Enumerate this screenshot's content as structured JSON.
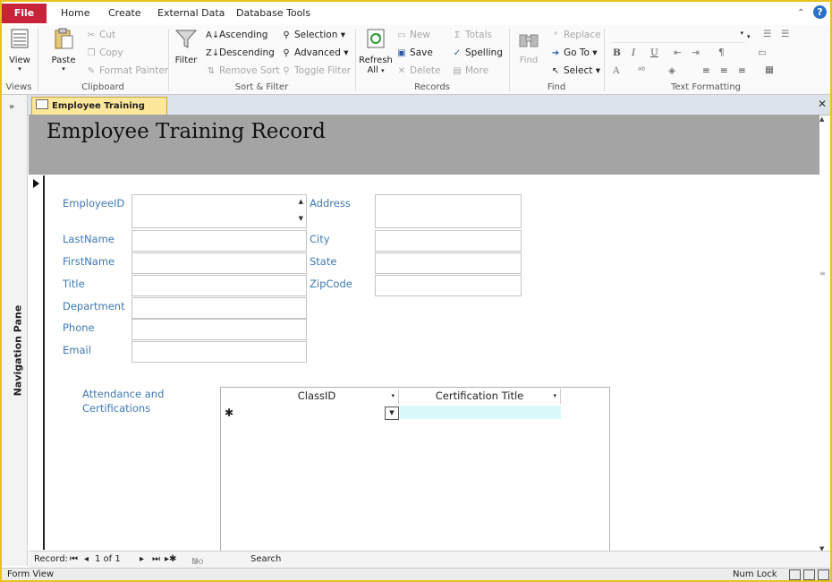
{
  "tabs": {
    "file": "File",
    "home": "Home",
    "create": "Create",
    "external": "External Data",
    "dbtools": "Database Tools"
  },
  "ribbon": {
    "views": {
      "label": "Views",
      "view": "View"
    },
    "clipboard": {
      "label": "Clipboard",
      "paste": "Paste",
      "cut": "Cut",
      "copy": "Copy",
      "format_painter": "Format Painter"
    },
    "sort": {
      "label": "Sort & Filter",
      "filter": "Filter",
      "ascending": "Ascending",
      "descending": "Descending",
      "remove_sort": "Remove Sort",
      "selection": "Selection",
      "advanced": "Advanced",
      "toggle_filter": "Toggle Filter"
    },
    "records": {
      "label": "Records",
      "refresh": "Refresh",
      "refresh2": "All",
      "new": "New",
      "save": "Save",
      "delete": "Delete",
      "totals": "Totals",
      "spelling": "Spelling",
      "more": "More"
    },
    "find": {
      "label": "Find",
      "find": "Find",
      "replace": "Replace",
      "goto": "Go To",
      "select": "Select"
    },
    "text": {
      "label": "Text Formatting",
      "bold": "B",
      "italic": "I",
      "underline": "U",
      "fontcolor": "A"
    }
  },
  "nav_pane": {
    "label": "Navigation Pane"
  },
  "doc": {
    "tab": "Employee Training Record",
    "title": "Employee Training Record"
  },
  "form": {
    "employeeid": "EmployeeID",
    "lastname": "LastName",
    "firstname": "FirstName",
    "title": "Title",
    "department": "Department",
    "phone": "Phone",
    "email": "Email",
    "address": "Address",
    "city": "City",
    "state": "State",
    "zipcode": "ZipCode"
  },
  "subform": {
    "label1": "Attendance and",
    "label2": "Certifications",
    "col1": "ClassID",
    "col2": "Certification Title",
    "new_row": "✱"
  },
  "recnav": {
    "record": "Record:",
    "position": "1 of 1",
    "nofilter": "No Filter",
    "search": "Search"
  },
  "status": {
    "view": "Form View",
    "numlock": "Num Lock"
  },
  "colors": {
    "file_tab": "#c8233b",
    "label_blue": "#3e78b3",
    "header_gray": "#a4a4a4",
    "doc_tab": "#fde79a",
    "cert_cell": "#d8fafa"
  }
}
